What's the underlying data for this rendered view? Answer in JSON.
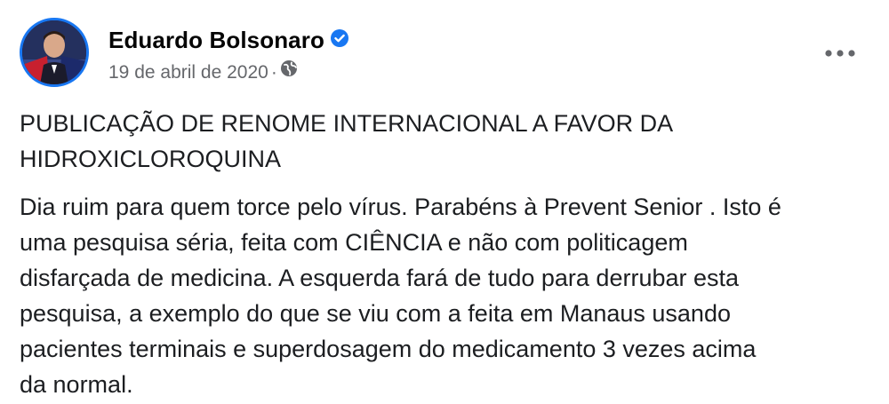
{
  "post": {
    "author": "Eduardo Bolsonaro",
    "date": "19 de abril de 2020",
    "separator": "·",
    "headline_line1": "PUBLICAÇÃO DE RENOME INTERNACIONAL A FAVOR DA",
    "headline_line2": "HIDROXICLOROQUINA",
    "body_lines": [
      "Dia ruim para quem torce pelo vírus. Parabéns à Prevent Senior . Isto é",
      "uma pesquisa séria, feita com CIÊNCIA e não com politicagem",
      "disfarçada de medicina. A esquerda fará de tudo para derrubar esta",
      "pesquisa, a exemplo do que se viu com a feita em Manaus usando",
      "pacientes terminais e superdosagem do medicamento 3 vezes acima",
      "da normal."
    ]
  },
  "icons": {
    "verified": "verified-badge-icon",
    "audience": "globe-icon",
    "more": "more-options-icon"
  },
  "colors": {
    "verified_blue": "#1877f2",
    "meta_gray": "#65676b",
    "text": "#1c1e21"
  }
}
